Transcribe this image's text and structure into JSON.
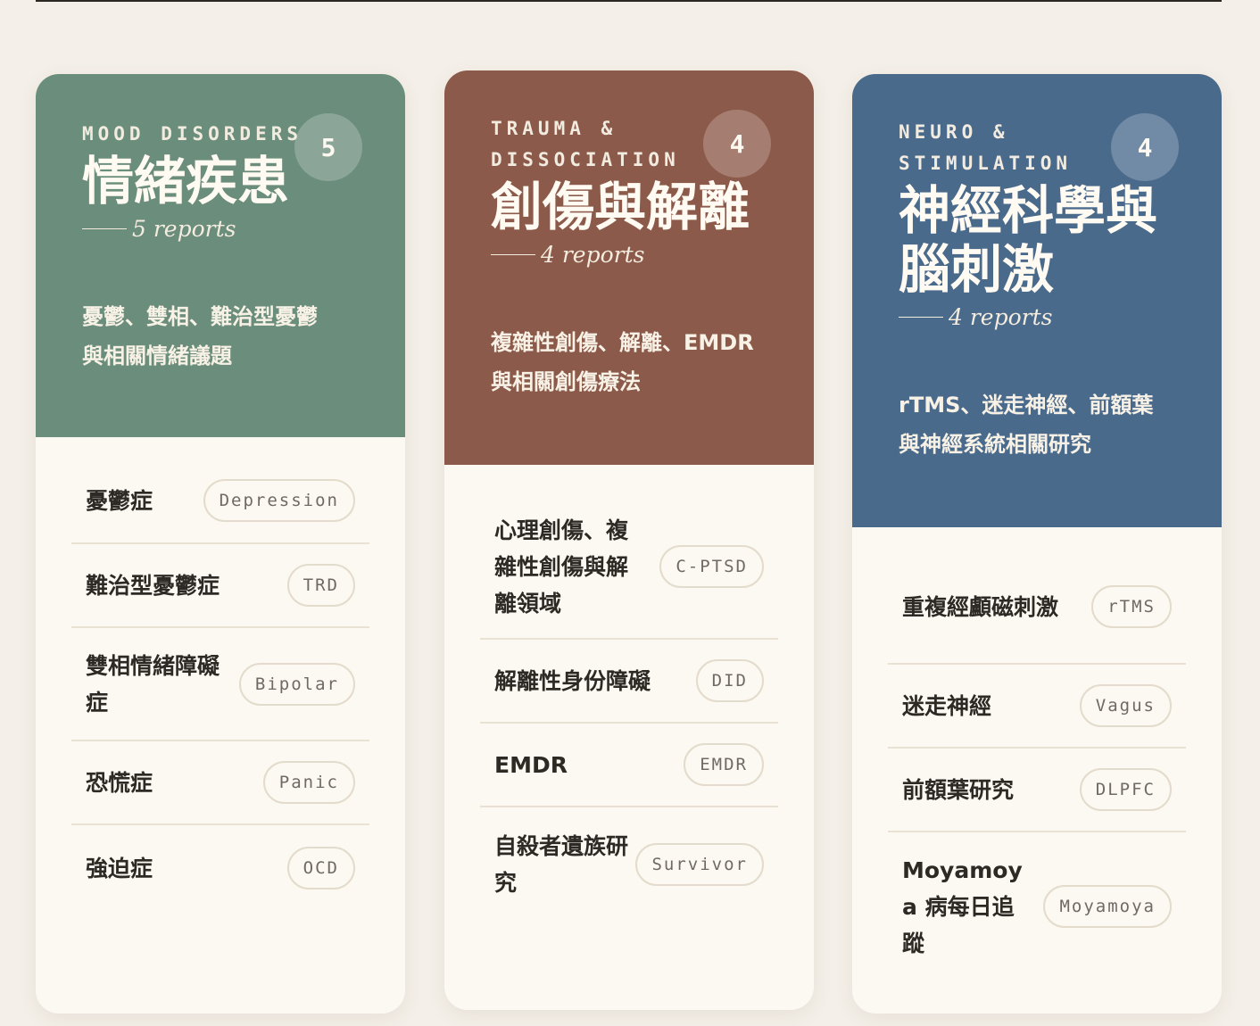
{
  "cards": [
    {
      "eyebrow": "MOOD DISORDERS",
      "count": "5",
      "title": "情緒疾患",
      "reports": "5 reports",
      "desc_line1": "憂鬱、雙相、難治型憂鬱",
      "desc_line2": "與相關情緒議題",
      "color": "#6b8d7b",
      "items": [
        {
          "label": "憂鬱症",
          "tag": "Depression"
        },
        {
          "label": "難治型憂鬱症",
          "tag": "TRD"
        },
        {
          "label": "雙相情緒障礙症",
          "tag": "Bipolar"
        },
        {
          "label": "恐慌症",
          "tag": "Panic"
        },
        {
          "label": "強迫症",
          "tag": "OCD"
        }
      ]
    },
    {
      "eyebrow": "TRAUMA & DISSOCIATION",
      "count": "4",
      "title": "創傷與解離",
      "reports": "4 reports",
      "desc_line1": "複雜性創傷、解離、EMDR",
      "desc_line2": "與相關創傷療法",
      "color": "#8c5a4a",
      "items": [
        {
          "label": "心理創傷、複雜性創傷與解離領域",
          "tag": "C-PTSD"
        },
        {
          "label": "解離性身份障礙",
          "tag": "DID"
        },
        {
          "label": "EMDR",
          "tag": "EMDR"
        },
        {
          "label": "自殺者遺族研究",
          "tag": "Survivor"
        }
      ]
    },
    {
      "eyebrow": "NEURO & STIMULATION",
      "count": "4",
      "title": "神經科學與腦刺激",
      "reports": "4 reports",
      "desc_line1": "rTMS、迷走神經、前額葉",
      "desc_line2": "與神經系統相關研究",
      "color": "#4a6a8c",
      "items": [
        {
          "label": "重複經顱磁刺激",
          "tag": "rTMS"
        },
        {
          "label": "迷走神經",
          "tag": "Vagus"
        },
        {
          "label": "前額葉研究",
          "tag": "DLPFC"
        },
        {
          "label": "Moyamoya 病每日追蹤",
          "tag": "Moyamoya"
        }
      ]
    }
  ]
}
